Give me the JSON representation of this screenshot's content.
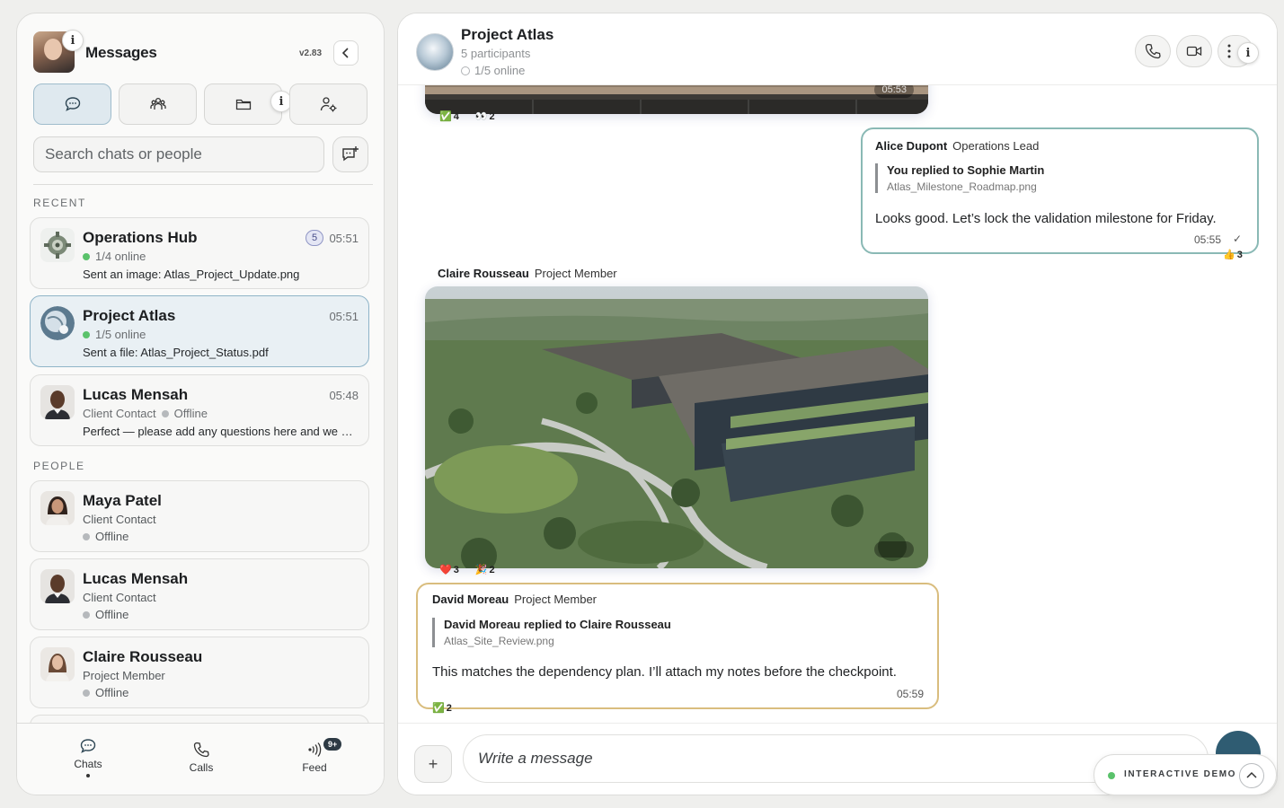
{
  "sidebar": {
    "title": "Messages",
    "version": "v2.83",
    "search": {
      "placeholder": "Search chats or people"
    },
    "sections": {
      "recent": "RECENT",
      "people": "PEOPLE"
    },
    "recent_chats": [
      {
        "name": "Operations Hub",
        "badge": "5",
        "time": "05:51",
        "status": "1/4 online",
        "preview": "Sent an image: Atlas_Project_Update.png"
      },
      {
        "name": "Project Atlas",
        "time": "05:51",
        "status": "1/5 online",
        "preview": "Sent a file: Atlas_Project_Status.pdf"
      },
      {
        "name": "Lucas Mensah",
        "time": "05:48",
        "role": "Client Contact",
        "status": "Offline",
        "preview": "Perfect — please add any questions here and we will review them together."
      }
    ],
    "people": [
      {
        "name": "Maya Patel",
        "role": "Client Contact",
        "status": "Offline"
      },
      {
        "name": "Lucas Mensah",
        "role": "Client Contact",
        "status": "Offline"
      },
      {
        "name": "Claire Rousseau",
        "role": "Project Member",
        "status": "Offline"
      }
    ],
    "bottom_nav": {
      "chats": "Chats",
      "calls": "Calls",
      "feed": "Feed",
      "feed_badge": "9+"
    }
  },
  "conversation": {
    "title": "Project Atlas",
    "participants": "5 participants",
    "online": "1/5 online",
    "messages": {
      "top_image": {
        "time": "05:53",
        "reactions": [
          {
            "emoji": "✅",
            "count": "4"
          },
          {
            "emoji": "👀",
            "count": "2"
          }
        ]
      },
      "alice": {
        "author": "Alice Dupont",
        "role": "Operations Lead",
        "reply_title": "You replied to Sophie Martin",
        "reply_file": "Atlas_Milestone_Roadmap.png",
        "text": "Looks good. Let’s lock the validation milestone for Friday.",
        "time": "05:55",
        "check": "✓",
        "reaction": {
          "emoji": "👍",
          "count": "3"
        }
      },
      "claire": {
        "author": "Claire Rousseau",
        "role": "Project Member",
        "reactions": [
          {
            "emoji": "❤️",
            "count": "3"
          },
          {
            "emoji": "🎉",
            "count": "2"
          }
        ]
      },
      "david": {
        "author": "David Moreau",
        "role": "Project Member",
        "reply_title": "David Moreau replied to Claire Rousseau",
        "reply_file": "Atlas_Site_Review.png",
        "text": "This matches the dependency plan. I’ll attach my notes before the checkpoint.",
        "time": "05:59",
        "reaction": {
          "emoji": "✅",
          "count": "2"
        }
      }
    },
    "composer": {
      "placeholder": "Write a message"
    }
  },
  "demo": {
    "label": "INTERACTIVE DEMO"
  },
  "colors": {
    "accent": "#2f5c72",
    "online": "#5ac26b",
    "teal_border": "#8ab9b5",
    "gold_border": "#d9bd7e"
  }
}
